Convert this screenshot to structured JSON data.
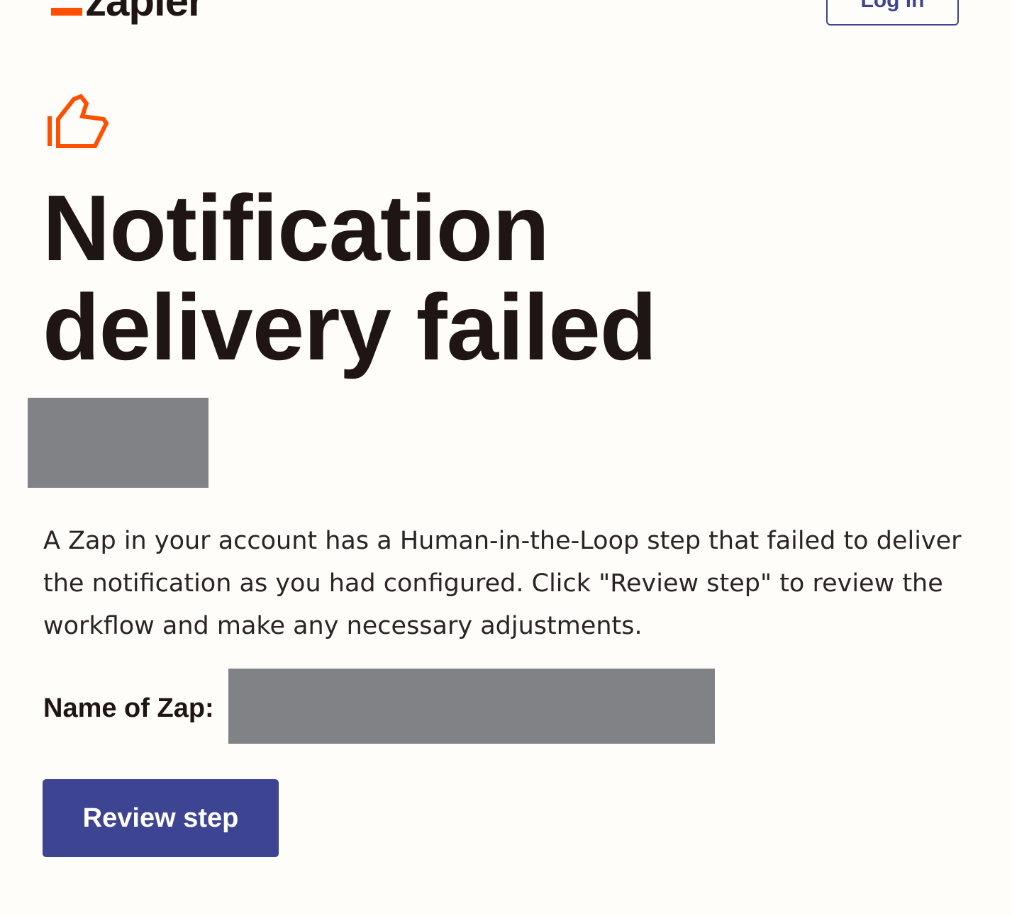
{
  "header": {
    "logo_text": "zapier",
    "login_label": "Log in"
  },
  "icons": {
    "status_icon": "thumbs-up-icon"
  },
  "colors": {
    "brand_orange": "#ff4f00",
    "primary_button": "#3d4592",
    "background": "#fffdf9",
    "redaction": "#818286"
  },
  "main": {
    "title_line1": "Notification",
    "title_line2": "delivery failed",
    "body": "A Zap in your account has a Human-in-the-Loop step that failed to deliver the notification as you had configured. Click \"Review step\" to review the workflow and make any necessary adjustments.",
    "zap_name_label": "Name of Zap:",
    "review_button_label": "Review step"
  }
}
